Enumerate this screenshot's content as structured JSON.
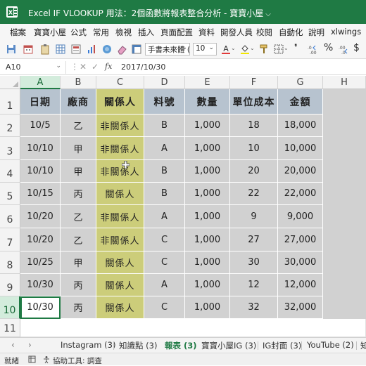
{
  "titlebar": {
    "title": "Excel IF VLOOKUP 用法：2個函數將報表整合分析  -  寶寶小屋",
    "dropdown_icon": "chevron-down-icon"
  },
  "menu": [
    "檔案",
    "寶寶小屋",
    "公式",
    "常用",
    "檢視",
    "插入",
    "頁面配置",
    "資料",
    "開發人員",
    "校閱",
    "自動化",
    "說明",
    "xlwings"
  ],
  "toolbar": {
    "font_name": "手書未來體 (",
    "font_size": "10",
    "accent": "#1f7a44"
  },
  "formula_bar": {
    "name_box": "A10",
    "cancel": "✕",
    "enter": "✓",
    "fx": "fx",
    "value": "2017/10/30"
  },
  "columns": [
    "A",
    "B",
    "C",
    "D",
    "E",
    "F",
    "G",
    "H"
  ],
  "rows": [
    "1",
    "2",
    "3",
    "4",
    "5",
    "6",
    "7",
    "8",
    "9",
    "10",
    "11"
  ],
  "table": {
    "headers": [
      "日期",
      "廠商",
      "關係人",
      "料號",
      "數量",
      "單位成本",
      "金額"
    ],
    "rows": [
      [
        "10/5",
        "乙",
        "非關係人",
        "B",
        "1,000",
        "18",
        "18,000"
      ],
      [
        "10/10",
        "甲",
        "非關係人",
        "A",
        "1,000",
        "10",
        "10,000"
      ],
      [
        "10/10",
        "甲",
        "非關係人",
        "B",
        "1,000",
        "20",
        "20,000"
      ],
      [
        "10/15",
        "丙",
        "關係人",
        "B",
        "1,000",
        "22",
        "22,000"
      ],
      [
        "10/20",
        "乙",
        "非關係人",
        "A",
        "1,000",
        "9",
        "9,000"
      ],
      [
        "10/20",
        "乙",
        "非關係人",
        "C",
        "1,000",
        "27",
        "27,000"
      ],
      [
        "10/25",
        "甲",
        "關係人",
        "C",
        "1,000",
        "30",
        "30,000"
      ],
      [
        "10/30",
        "丙",
        "關係人",
        "A",
        "1,000",
        "12",
        "12,000"
      ],
      [
        "10/30",
        "丙",
        "關係人",
        "C",
        "1,000",
        "32",
        "32,000"
      ]
    ]
  },
  "sheet_tabs": [
    "Instagram (3)",
    "知識點 (3)",
    "報表 (3)",
    "寶寶小屋IG (3)",
    "IG封面 (3)",
    "YouTube (2)",
    "知"
  ],
  "active_tab": "報表 (3)",
  "status": {
    "mode": "就緒",
    "accessibility": "協助工具: 調查"
  }
}
